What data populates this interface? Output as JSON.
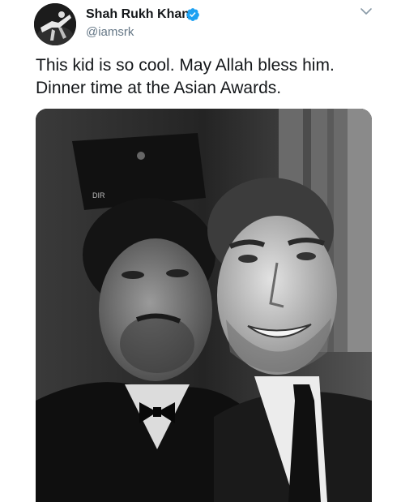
{
  "tweet": {
    "author": {
      "display_name": "Shah Rukh Khan",
      "handle": "@iamsrk",
      "verified": true,
      "verified_color": "#1da1f2",
      "avatar_icon": "avatar-photo"
    },
    "text_lines": [
      "This kid is so cool. May Allah bless him.",
      "Dinner time at the Asian Awards."
    ],
    "menu_icon": "chevron-down-icon",
    "media": {
      "type": "photo",
      "style": "black-and-white selfie of two men in suits",
      "photo_text": "DIR"
    }
  }
}
